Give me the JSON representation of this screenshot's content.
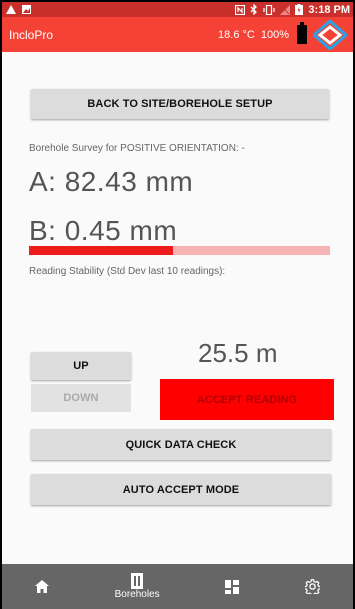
{
  "status_bar": {
    "time": "3:18 PM",
    "left_icons": [
      "warning-icon",
      "image-icon"
    ],
    "right_icons": [
      "nfc-icon",
      "bluetooth-icon",
      "vibrate-icon",
      "no-sim-icon",
      "battery-charging-icon"
    ]
  },
  "app_bar": {
    "title": "IncloPro",
    "temperature": "18.6 °C",
    "battery_percent": "100%",
    "logo_icon": "inclopro-diamond-logo"
  },
  "main": {
    "back_button_label": "BACK TO SITE/BOREHOLE SETUP",
    "survey_label": "Borehole Survey for POSITIVE ORIENTATION: -",
    "reading_a": "A:   82.43 mm",
    "reading_b": "B:   0.45 mm",
    "stability_label": "Reading Stability (Std Dev last 10 readings):",
    "stability_fraction": 0.48,
    "up_label": "UP",
    "down_label": "DOWN",
    "depth_value": "25.5 m",
    "accept_label": "ACCEPT READING",
    "quick_check_label": "QUICK DATA CHECK",
    "auto_accept_label": "AUTO ACCEPT MODE"
  },
  "bottom_nav": {
    "items": [
      {
        "icon": "home-icon",
        "label": ""
      },
      {
        "icon": "borehole-icon",
        "label": "Boreholes"
      },
      {
        "icon": "grid-icon",
        "label": ""
      },
      {
        "icon": "gear-icon",
        "label": ""
      }
    ]
  },
  "colors": {
    "app_bar": "#f44336",
    "status_bar": "#c9302c",
    "accept_button": "#ff0000",
    "stability_fill": "#ee1b1b",
    "stability_track": "#f5b3b3",
    "nav_bar": "#666666"
  }
}
